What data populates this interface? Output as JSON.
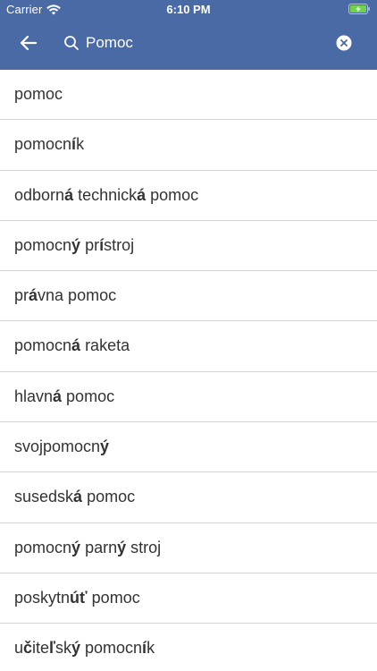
{
  "status_bar": {
    "carrier": "Carrier",
    "time": "6:10 PM"
  },
  "search": {
    "value": "Pomoc",
    "back_icon": "arrow-left-icon",
    "search_icon": "search-icon",
    "clear_icon": "clear-icon"
  },
  "colors": {
    "header": "#4a6aa6",
    "text": "#333333",
    "divider": "#d4d4d4"
  },
  "results": [
    [
      {
        "t": "pomoc",
        "b": false
      }
    ],
    [
      {
        "t": "pomocn",
        "b": false
      },
      {
        "t": "í",
        "b": true
      },
      {
        "t": "k",
        "b": false
      }
    ],
    [
      {
        "t": "odborn",
        "b": false
      },
      {
        "t": "á",
        "b": true
      },
      {
        "t": " technick",
        "b": false
      },
      {
        "t": "á",
        "b": true
      },
      {
        "t": " pomoc",
        "b": false
      }
    ],
    [
      {
        "t": "pomocn",
        "b": false
      },
      {
        "t": "ý",
        "b": true
      },
      {
        "t": " pr",
        "b": false
      },
      {
        "t": "í",
        "b": true
      },
      {
        "t": "stroj",
        "b": false
      }
    ],
    [
      {
        "t": "pr",
        "b": false
      },
      {
        "t": "á",
        "b": true
      },
      {
        "t": "vna pomoc",
        "b": false
      }
    ],
    [
      {
        "t": "pomocn",
        "b": false
      },
      {
        "t": "á",
        "b": true
      },
      {
        "t": " raketa",
        "b": false
      }
    ],
    [
      {
        "t": "hlavn",
        "b": false
      },
      {
        "t": "á",
        "b": true
      },
      {
        "t": " pomoc",
        "b": false
      }
    ],
    [
      {
        "t": "svojpomocn",
        "b": false
      },
      {
        "t": "ý",
        "b": true
      }
    ],
    [
      {
        "t": "susedsk",
        "b": false
      },
      {
        "t": "á",
        "b": true
      },
      {
        "t": " pomoc",
        "b": false
      }
    ],
    [
      {
        "t": "pomocn",
        "b": false
      },
      {
        "t": "ý",
        "b": true
      },
      {
        "t": " parn",
        "b": false
      },
      {
        "t": "ý",
        "b": true
      },
      {
        "t": " stroj",
        "b": false
      }
    ],
    [
      {
        "t": "poskytn",
        "b": false
      },
      {
        "t": "úť",
        "b": true
      },
      {
        "t": " pomoc",
        "b": false
      }
    ],
    [
      {
        "t": "u",
        "b": false
      },
      {
        "t": "č",
        "b": true
      },
      {
        "t": "ite",
        "b": false
      },
      {
        "t": "ľ",
        "b": true
      },
      {
        "t": "sk",
        "b": false
      },
      {
        "t": "ý",
        "b": true
      },
      {
        "t": " pomocn",
        "b": false
      },
      {
        "t": "í",
        "b": true
      },
      {
        "t": "k",
        "b": false
      }
    ]
  ]
}
